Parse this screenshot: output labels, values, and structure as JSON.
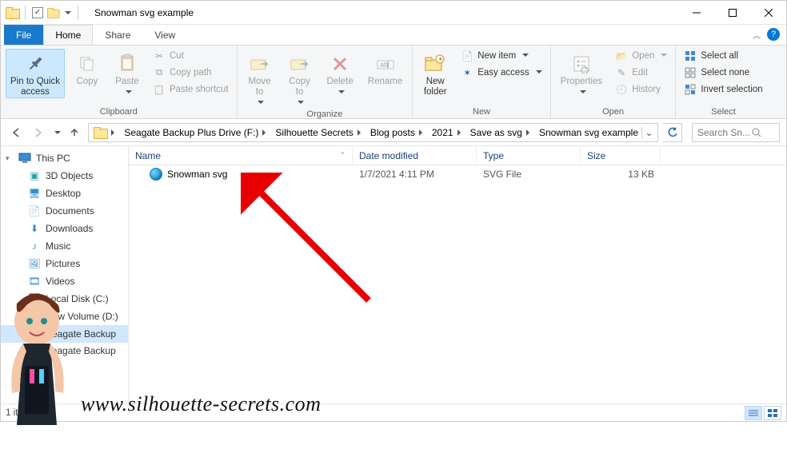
{
  "window": {
    "title": "Snowman svg example"
  },
  "tabs": {
    "file": "File",
    "home": "Home",
    "share": "Share",
    "view": "View"
  },
  "ribbon": {
    "clipboard": {
      "label": "Clipboard",
      "pin": "Pin to Quick\naccess",
      "copy": "Copy",
      "paste": "Paste",
      "cut": "Cut",
      "copy_path": "Copy path",
      "paste_shortcut": "Paste shortcut"
    },
    "organize": {
      "label": "Organize",
      "move_to": "Move\nto",
      "copy_to": "Copy\nto",
      "delete": "Delete",
      "rename": "Rename"
    },
    "new": {
      "label": "New",
      "new_folder": "New\nfolder",
      "new_item": "New item",
      "easy_access": "Easy access"
    },
    "open": {
      "label": "Open",
      "properties": "Properties",
      "open": "Open",
      "edit": "Edit",
      "history": "History"
    },
    "select": {
      "label": "Select",
      "select_all": "Select all",
      "select_none": "Select none",
      "invert": "Invert selection"
    }
  },
  "breadcrumbs": [
    "Seagate Backup Plus Drive (F:)",
    "Silhouette Secrets",
    "Blog posts",
    "2021",
    "Save as svg",
    "Snowman svg example"
  ],
  "search_placeholder": "Search Sn...",
  "columns": {
    "name": "Name",
    "date": "Date modified",
    "type": "Type",
    "size": "Size"
  },
  "navpane": {
    "this_pc": "This PC",
    "items": [
      "3D Objects",
      "Desktop",
      "Documents",
      "Downloads",
      "Music",
      "Pictures",
      "Videos",
      "Local Disk (C:)",
      "New Volume (D:)",
      "Seagate Backup",
      "Seagate Backup P"
    ]
  },
  "files": [
    {
      "name": "Snowman svg",
      "date": "1/7/2021 4:11 PM",
      "type": "SVG File",
      "size": "13 KB"
    }
  ],
  "status": {
    "count": "1 item"
  },
  "watermark_url": "www.silhouette-secrets.com"
}
